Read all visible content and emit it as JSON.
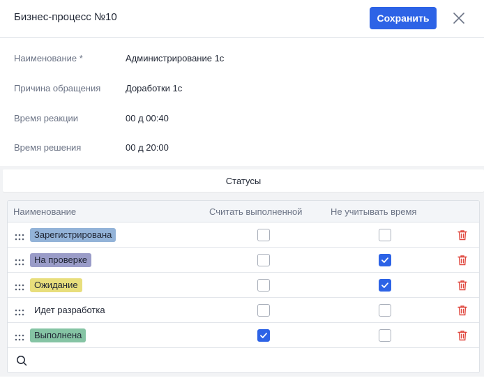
{
  "header": {
    "title": "Бизнес-процесс №10",
    "save_label": "Сохранить",
    "close_icon": "close-icon"
  },
  "fields": [
    {
      "label": "Наименование *",
      "value": "Администрирование 1с"
    },
    {
      "label": "Причина обращения",
      "value": "Доработки 1с"
    },
    {
      "label": "Время реакции",
      "value": "00 д 00:40"
    },
    {
      "label": "Время решения",
      "value": "00 д 20:00"
    }
  ],
  "statuses_tab": {
    "label": "Статусы"
  },
  "table": {
    "columns": [
      "Наименование",
      "Считать выполненной",
      "Не учитывать время"
    ],
    "rows": [
      {
        "name": "Зарегистрирована",
        "color": "#93b3d8",
        "count_done": false,
        "ignore_time": false
      },
      {
        "name": "На проверке",
        "color": "#9a9cc8",
        "count_done": false,
        "ignore_time": true
      },
      {
        "name": "Ожидание",
        "color": "#e8de7c",
        "count_done": false,
        "ignore_time": true
      },
      {
        "name": "Идет разработка",
        "color": "",
        "count_done": false,
        "ignore_time": false
      },
      {
        "name": "Выполнена",
        "color": "#85c4a4",
        "count_done": true,
        "ignore_time": false
      }
    ]
  },
  "colors": {
    "accent": "#2d63e6",
    "delete": "#e0463d"
  }
}
